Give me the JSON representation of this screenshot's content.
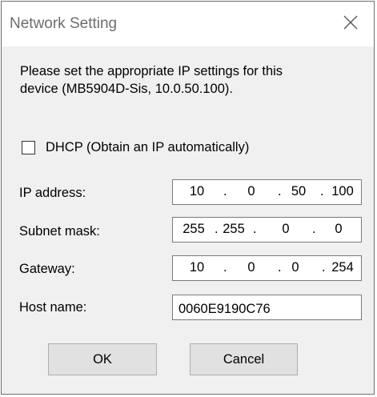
{
  "window": {
    "title": "Network Setting"
  },
  "message": {
    "line1": "Please set the appropriate IP settings for this",
    "line2": "device (MB5904D-Sis, 10.0.50.100)."
  },
  "dhcp": {
    "label": "DHCP (Obtain an IP automatically)",
    "checked": false
  },
  "fields": {
    "ip_address": {
      "label": "IP address:",
      "octets": [
        "10",
        "0",
        "50",
        "100"
      ]
    },
    "subnet_mask": {
      "label": "Subnet mask:",
      "octets": [
        "255",
        "255",
        "0",
        "0"
      ]
    },
    "gateway": {
      "label": "Gateway:",
      "octets": [
        "10",
        "0",
        "0",
        "254"
      ]
    },
    "host_name": {
      "label": "Host name:",
      "value": "0060E9190C76"
    }
  },
  "separator": ".",
  "buttons": {
    "ok": "OK",
    "cancel": "Cancel"
  }
}
